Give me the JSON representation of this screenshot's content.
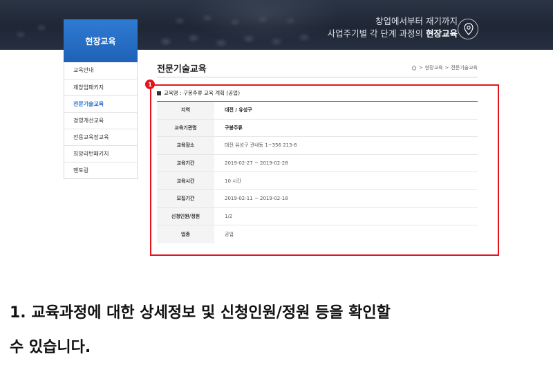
{
  "hero": {
    "line1": "창업에서부터 재기까지",
    "line2_prefix": "사업주기별 각 단계 과정의 ",
    "line2_bold": "현장교육",
    "icon": "location-pin-icon"
  },
  "sidebar": {
    "title": "현장교육",
    "items": [
      {
        "label": "교육안내",
        "active": false
      },
      {
        "label": "재창업패키지",
        "active": false
      },
      {
        "label": "전문기술교육",
        "active": true
      },
      {
        "label": "경영개선교육",
        "active": false
      },
      {
        "label": "전용교육장교육",
        "active": false
      },
      {
        "label": "희망리턴패키지",
        "active": false
      },
      {
        "label": "멘토링",
        "active": false
      }
    ]
  },
  "content": {
    "title": "전문기술교육",
    "breadcrumb": [
      "현장교육",
      "전문기술교육"
    ],
    "badge": "1",
    "course_header": "교육명 : 구봉주류 교육 계획 (공업)"
  },
  "table": {
    "rows": [
      {
        "label": "지역",
        "value": "대전 / 유성구",
        "emph": true
      },
      {
        "label": "교육기관명",
        "value": "구봉주류",
        "emph": true
      },
      {
        "label": "교육장소",
        "value": "대전 유성구 관내동 1~356 213-8",
        "emph": false
      },
      {
        "label": "교육기간",
        "value": "2019-02-27 ~ 2019-02-28",
        "emph": false
      },
      {
        "label": "교육시간",
        "value": "10 시간",
        "emph": false
      },
      {
        "label": "모집기간",
        "value": "2019-02-11 ~ 2019-02-18",
        "emph": false
      },
      {
        "label": "신청인원/정원",
        "value": "1/2",
        "emph": false
      },
      {
        "label": "업종",
        "value": "공업",
        "emph": false
      }
    ]
  },
  "caption": {
    "line1": "1. 교육과정에 대한 상세정보 및 신청인원/정원 등을 확인할",
    "line2": "수 있습니다."
  },
  "colors": {
    "accent_blue": "#2a6fcf",
    "highlight_red": "#e5141c"
  }
}
